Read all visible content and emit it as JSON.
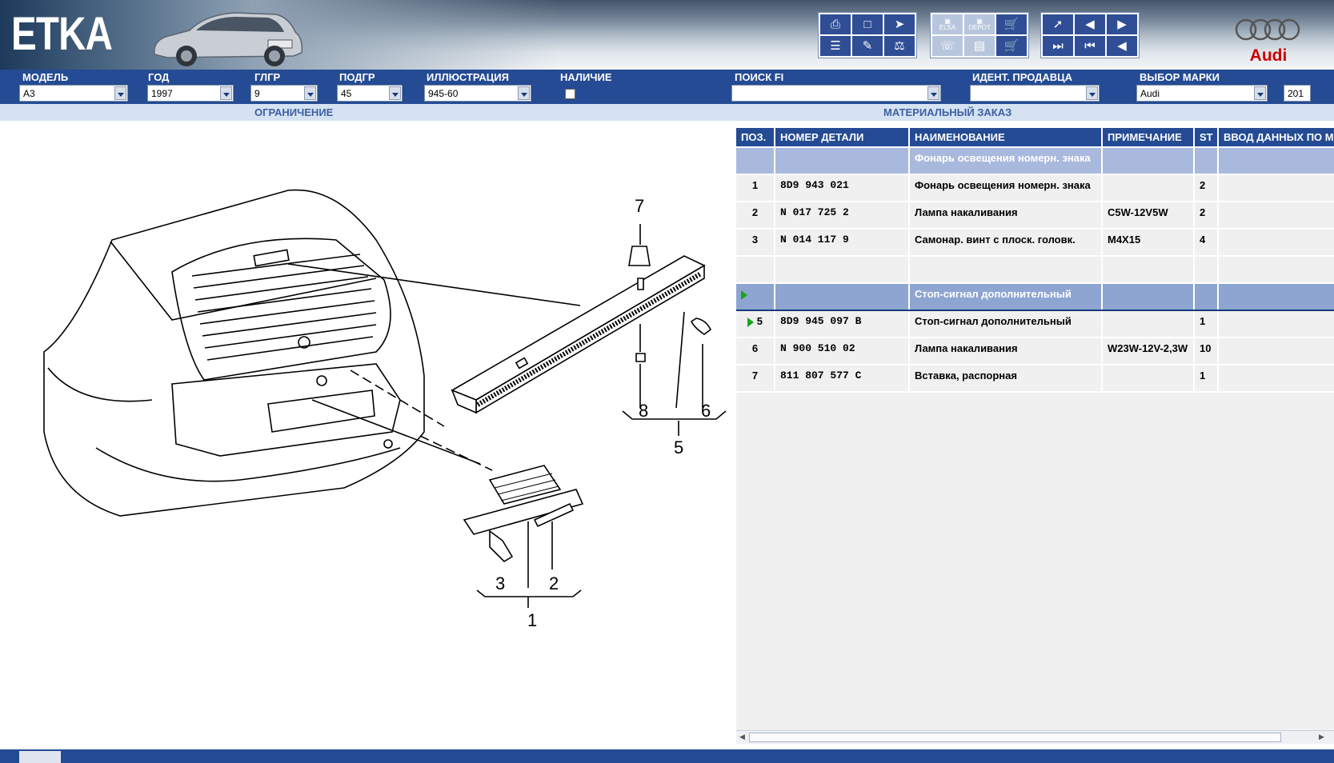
{
  "app": {
    "logo": "ETKA",
    "brand_logo_text": "Audi"
  },
  "toolbar": {
    "group1": [
      "printer-icon",
      "screen-icon",
      "share-icon",
      "list-icon",
      "pencil-icon",
      "scale-icon"
    ],
    "group2": [
      "elsa-icon",
      "depot-icon",
      "cart-arrow-icon",
      "phone-icon",
      "page-icon",
      "cart-icon"
    ],
    "group3": [
      "pin-icon",
      "prev-page-icon",
      "page-icon",
      "first-icon",
      "back-icon",
      "prev-icon"
    ],
    "labels": {
      "elsa": "ELSA",
      "depot": "DEPOT"
    }
  },
  "fields": {
    "model": {
      "label": "МОДЕЛЬ",
      "value": "A3"
    },
    "year": {
      "label": "ГОД",
      "value": "1997"
    },
    "mgroup": {
      "label": "ГЛГР",
      "value": "9"
    },
    "subgroup": {
      "label": "ПОДГР",
      "value": "45"
    },
    "illustration": {
      "label": "ИЛЛЮСТРАЦИЯ",
      "value": "945-60"
    },
    "availability": {
      "label": "НАЛИЧИЕ"
    },
    "search": {
      "label": "ПОИСК FI",
      "value": ""
    },
    "seller": {
      "label": "ИДЕНТ. ПРОДАВЦА",
      "value": ""
    },
    "brand": {
      "label": "ВЫБОР МАРКИ",
      "value": "Audi"
    },
    "extra": {
      "value": "201"
    }
  },
  "sections": {
    "restriction": "ОГРАНИЧЕНИЕ",
    "material_order": "МАТЕРИАЛЬНЫЙ ЗАКАЗ"
  },
  "callouts": [
    "7",
    "8",
    "6",
    "5",
    "3",
    "2",
    "1"
  ],
  "table": {
    "columns": [
      "ПОЗ.",
      "НОМЕР ДЕТАЛИ",
      "НАИМЕНОВАНИЕ",
      "ПРИМЕЧАНИЕ",
      "ST",
      "ВВОД ДАННЫХ ПО МОДЕЛИ"
    ],
    "rows": [
      {
        "type": "header",
        "pos": "",
        "part": "",
        "name": "Фонарь освещения номерн. знака",
        "note": "",
        "st": "",
        "data": ""
      },
      {
        "type": "item",
        "pos": "1",
        "part": "8D9 943 021",
        "name": "Фонарь освещения номерн. знака",
        "note": "",
        "st": "2",
        "data": ""
      },
      {
        "type": "item",
        "pos": "2",
        "part": "N   017 725 2",
        "name": "Лампа накаливания",
        "note": "C5W-12V5W",
        "st": "2",
        "data": ""
      },
      {
        "type": "item",
        "pos": "3",
        "part": "N   014 117 9",
        "name": "Самонар. винт с плоск. головк.",
        "note": "M4X15",
        "st": "4",
        "data": ""
      },
      {
        "type": "empty",
        "pos": "",
        "part": "",
        "name": "",
        "note": "",
        "st": "",
        "data": ""
      },
      {
        "type": "header-selected",
        "pos": "",
        "part": "",
        "name": "Стоп-сигнал дополнительный",
        "note": "",
        "st": "",
        "data": ""
      },
      {
        "type": "item-marked",
        "pos": "5",
        "part": "8D9 945 097 B",
        "name": "Стоп-сигнал дополнительный",
        "note": "",
        "st": "1",
        "data": ""
      },
      {
        "type": "item",
        "pos": "6",
        "part": "N   900 510 02",
        "name": "Лампа накаливания",
        "note": "W23W-12V-2,3W",
        "st": "10",
        "data": ""
      },
      {
        "type": "item",
        "pos": "7",
        "part": "811 807 577 C",
        "name": "Вставка, распорная",
        "note": "",
        "st": "1",
        "data": ""
      }
    ]
  },
  "colors": {
    "bar": "#244b93",
    "section_bg": "#d4e2f2",
    "row_header": "#a9b9de",
    "marker": "#17a51c",
    "brand_red": "#cc0000"
  }
}
